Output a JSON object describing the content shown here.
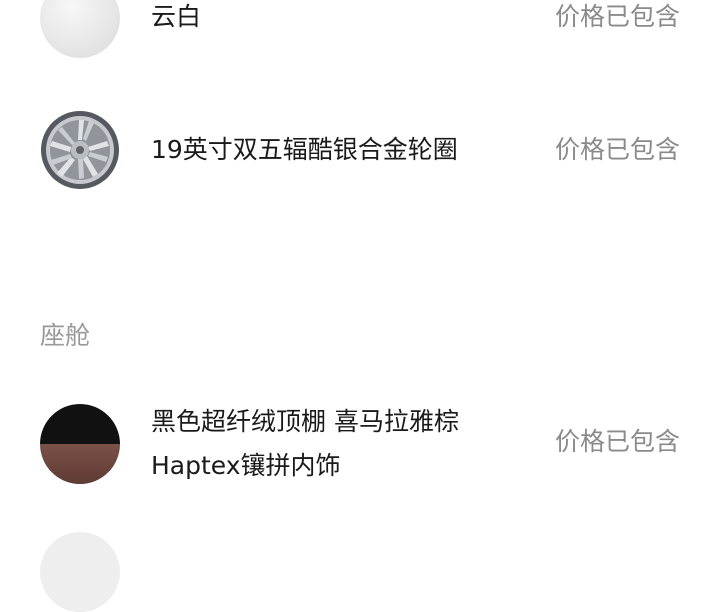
{
  "items": [
    {
      "name": "云白",
      "price": "价格已包含",
      "swatch_icon": "white-paint-swatch-icon",
      "color": "#e6e6e6"
    },
    {
      "name": "19英寸双五辐酷银合金轮圈",
      "price": "价格已包含",
      "swatch_icon": "alloy-wheel-icon",
      "color": "#b8bcc0"
    }
  ],
  "section_title": "座舱",
  "cabin_items": [
    {
      "name_line1": "黑色超纤绒顶棚 喜马拉雅棕",
      "name_line2": "Haptex镶拼内饰",
      "price": "价格已包含",
      "swatch_icon": "black-brown-interior-swatch-icon",
      "colors": [
        "#111111",
        "#6f473f"
      ]
    }
  ]
}
